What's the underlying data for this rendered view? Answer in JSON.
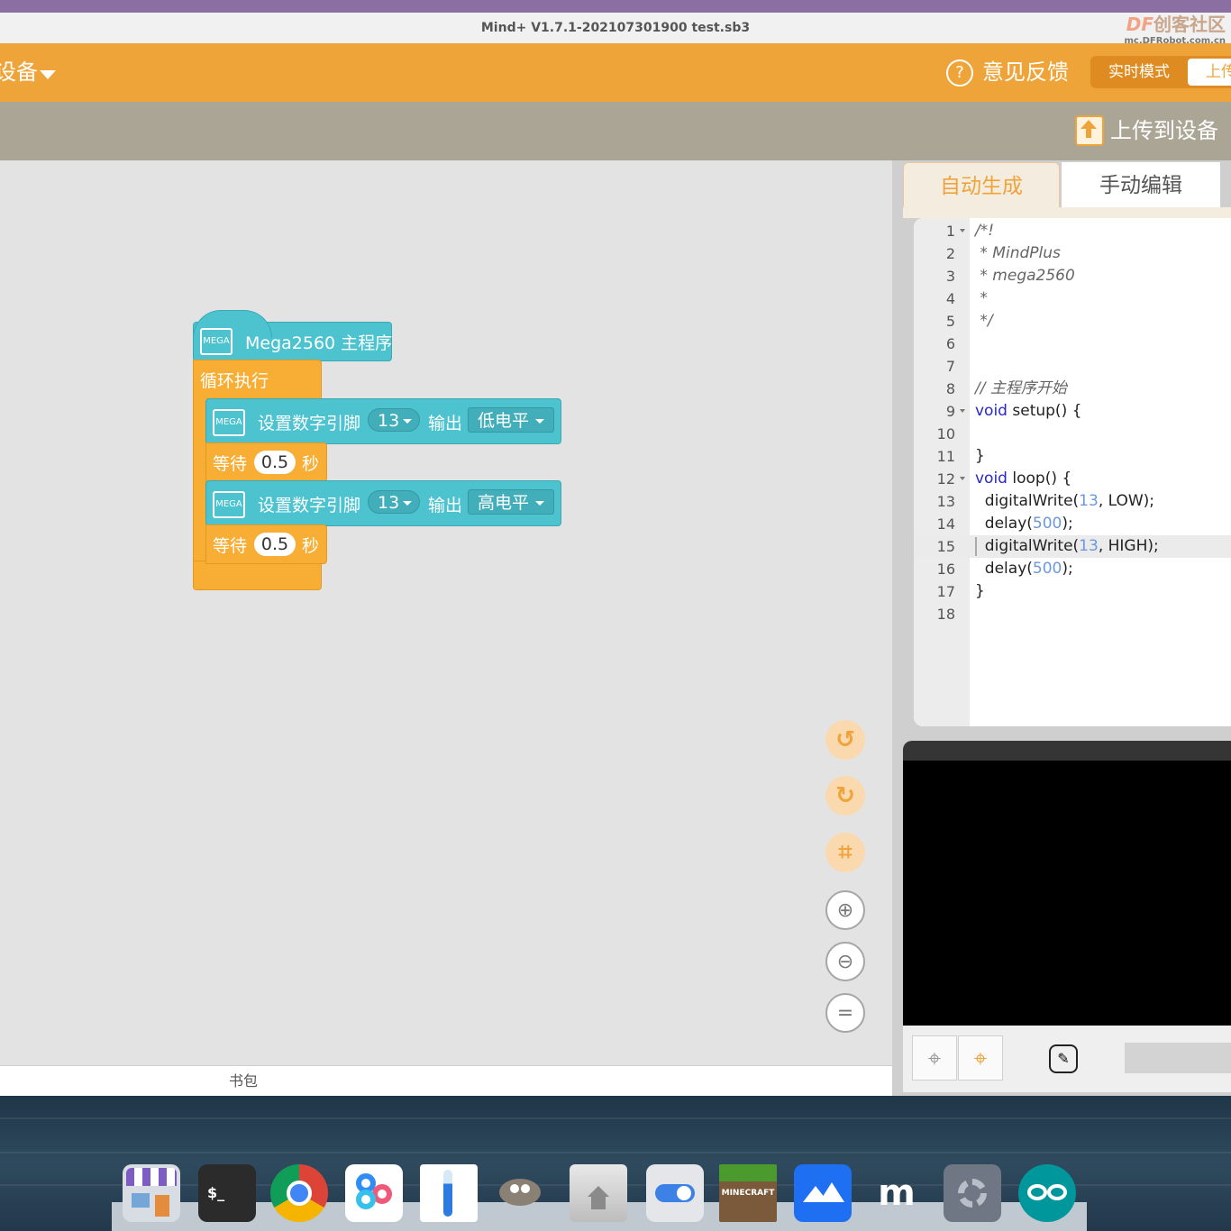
{
  "window": {
    "title": "Mind+ V1.7.1-202107301900   test.sb3",
    "logo_prefix": "DF",
    "logo_text": "创客社区",
    "logo_url": "mc.DFRobot.com.cn"
  },
  "toolbar": {
    "device_menu": "设备",
    "feedback": "意见反馈",
    "mode_realtime": "实时模式",
    "mode_upload": "上传"
  },
  "actionbar": {
    "upload_to_device": "上传到设备"
  },
  "blocks": {
    "hat_icon": "MEGA",
    "hat_label": "Mega2560 主程序",
    "loop_label": "循环执行",
    "set_pin_label": "设置数字引脚",
    "pin_value": "13",
    "output_label": "输出",
    "level_low": "低电平",
    "level_high": "高电平",
    "wait_label": "等待",
    "wait_value": "0.5",
    "seconds_label": "秒"
  },
  "zoom": {
    "equal_symbol": "="
  },
  "backpack": {
    "label": "书包"
  },
  "code_tabs": {
    "auto": "自动生成",
    "manual": "手动编辑"
  },
  "code": {
    "line_numbers": [
      "1",
      "2",
      "3",
      "4",
      "5",
      "6",
      "7",
      "8",
      "9",
      "10",
      "11",
      "12",
      "13",
      "14",
      "15",
      "16",
      "17",
      "18"
    ],
    "l1": "/*!",
    "l2": " * MindPlus",
    "l3": " * mega2560",
    "l4": " *",
    "l5": " */",
    "l8": "// 主程序开始",
    "kw_void": "void",
    "setup_sig": " setup() {",
    "close_brace": "}",
    "loop_sig": " loop() {",
    "dw_open": "  digitalWrite(",
    "pin": "13",
    "dw_low_tail": ", LOW);",
    "dw_high_tail": ", HIGH);",
    "delay_open": "  delay(",
    "delay_val": "500",
    "delay_tail": ");"
  },
  "colors": {
    "toolbar_orange": "#efa43a",
    "block_teal": "#4cc3cf",
    "block_orange": "#f8ae35",
    "keyword_blue": "#2a27c6"
  },
  "dock": {
    "terminal_glyph": "$_",
    "minecraft_label": "MINECRAFT",
    "mu_glyph": "m"
  }
}
